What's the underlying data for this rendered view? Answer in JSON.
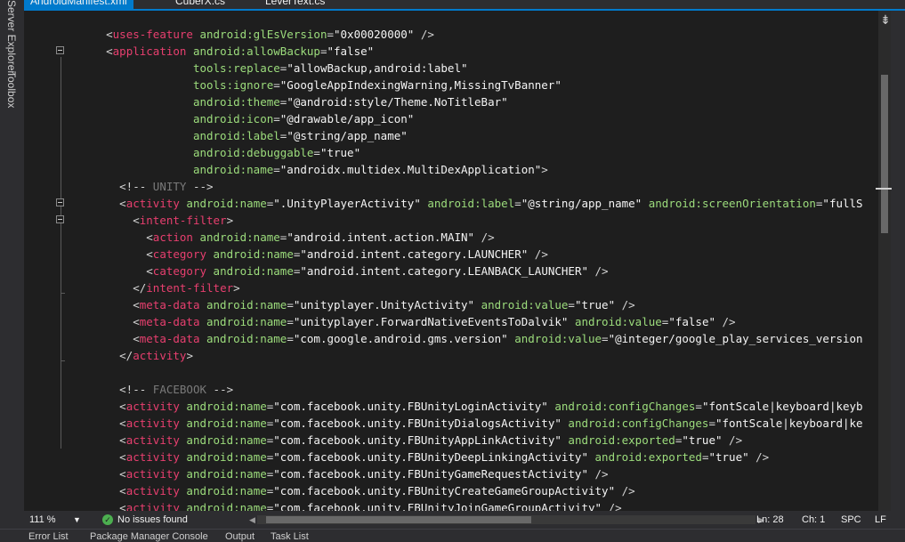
{
  "sidebar": {
    "server_explorer": "Server Explorer",
    "toolbox": "Toolbox"
  },
  "tabs": [
    {
      "label": "AndroidManifest.xml",
      "active": true
    },
    {
      "label": "CuberX.cs",
      "active": false
    },
    {
      "label": "LeverText.cs",
      "active": false
    }
  ],
  "code_lines": [
    [
      [
        "    ",
        "b"
      ],
      [
        "<",
        "b"
      ],
      [
        "uses-feature",
        "e"
      ],
      [
        " android:glEsVersion",
        "a"
      ],
      [
        "=",
        "b"
      ],
      [
        "\"0x00020000\"",
        "v"
      ],
      [
        " />",
        "b"
      ]
    ],
    [
      [
        "    ",
        "b"
      ],
      [
        "<",
        "b"
      ],
      [
        "application",
        "e"
      ],
      [
        " android:allowBackup",
        "a"
      ],
      [
        "=",
        "b"
      ],
      [
        "\"false\"",
        "v"
      ]
    ],
    [
      [
        "                 ",
        "b"
      ],
      [
        "tools:replace",
        "a"
      ],
      [
        "=",
        "b"
      ],
      [
        "\"allowBackup,android:label\"",
        "v"
      ]
    ],
    [
      [
        "                 ",
        "b"
      ],
      [
        "tools:ignore",
        "a"
      ],
      [
        "=",
        "b"
      ],
      [
        "\"GoogleAppIndexingWarning,MissingTvBanner\"",
        "v"
      ]
    ],
    [
      [
        "                 ",
        "b"
      ],
      [
        "android:theme",
        "a"
      ],
      [
        "=",
        "b"
      ],
      [
        "\"@android:style/Theme.NoTitleBar\"",
        "v"
      ]
    ],
    [
      [
        "                 ",
        "b"
      ],
      [
        "android:icon",
        "a"
      ],
      [
        "=",
        "b"
      ],
      [
        "\"@drawable/app_icon\"",
        "v"
      ]
    ],
    [
      [
        "                 ",
        "b"
      ],
      [
        "android:label",
        "a"
      ],
      [
        "=",
        "b"
      ],
      [
        "\"@string/app_name\"",
        "v"
      ]
    ],
    [
      [
        "                 ",
        "b"
      ],
      [
        "android:debuggable",
        "a"
      ],
      [
        "=",
        "b"
      ],
      [
        "\"true\"",
        "v"
      ]
    ],
    [
      [
        "                 ",
        "b"
      ],
      [
        "android:name",
        "a"
      ],
      [
        "=",
        "b"
      ],
      [
        "\"androidx.multidex.MultiDexApplication\"",
        "v"
      ],
      [
        ">",
        "b"
      ]
    ],
    [
      [
        "      ",
        "b"
      ],
      [
        "<!-- ",
        "b"
      ],
      [
        "UNITY",
        "c"
      ],
      [
        " -->",
        "b"
      ]
    ],
    [
      [
        "      ",
        "b"
      ],
      [
        "<",
        "b"
      ],
      [
        "activity",
        "e"
      ],
      [
        " android:name",
        "a"
      ],
      [
        "=",
        "b"
      ],
      [
        "\".UnityPlayerActivity\"",
        "v"
      ],
      [
        " android:label",
        "a"
      ],
      [
        "=",
        "b"
      ],
      [
        "\"@string/app_name\"",
        "v"
      ],
      [
        " android:screenOrientation",
        "a"
      ],
      [
        "=",
        "b"
      ],
      [
        "\"fullS",
        "v"
      ]
    ],
    [
      [
        "        ",
        "b"
      ],
      [
        "<",
        "b"
      ],
      [
        "intent-filter",
        "e"
      ],
      [
        ">",
        "b"
      ]
    ],
    [
      [
        "          ",
        "b"
      ],
      [
        "<",
        "b"
      ],
      [
        "action",
        "e"
      ],
      [
        " android:name",
        "a"
      ],
      [
        "=",
        "b"
      ],
      [
        "\"android.intent.action.MAIN\"",
        "v"
      ],
      [
        " />",
        "b"
      ]
    ],
    [
      [
        "          ",
        "b"
      ],
      [
        "<",
        "b"
      ],
      [
        "category",
        "e"
      ],
      [
        " android:name",
        "a"
      ],
      [
        "=",
        "b"
      ],
      [
        "\"android.intent.category.LAUNCHER\"",
        "v"
      ],
      [
        " />",
        "b"
      ]
    ],
    [
      [
        "          ",
        "b"
      ],
      [
        "<",
        "b"
      ],
      [
        "category",
        "e"
      ],
      [
        " android:name",
        "a"
      ],
      [
        "=",
        "b"
      ],
      [
        "\"android.intent.category.LEANBACK_LAUNCHER\"",
        "v"
      ],
      [
        " />",
        "b"
      ]
    ],
    [
      [
        "        ",
        "b"
      ],
      [
        "</",
        "b"
      ],
      [
        "intent-filter",
        "e"
      ],
      [
        ">",
        "b"
      ]
    ],
    [
      [
        "        ",
        "b"
      ],
      [
        "<",
        "b"
      ],
      [
        "meta-data",
        "e"
      ],
      [
        " android:name",
        "a"
      ],
      [
        "=",
        "b"
      ],
      [
        "\"unityplayer.UnityActivity\"",
        "v"
      ],
      [
        " android:value",
        "a"
      ],
      [
        "=",
        "b"
      ],
      [
        "\"true\"",
        "v"
      ],
      [
        " />",
        "b"
      ]
    ],
    [
      [
        "        ",
        "b"
      ],
      [
        "<",
        "b"
      ],
      [
        "meta-data",
        "e"
      ],
      [
        " android:name",
        "a"
      ],
      [
        "=",
        "b"
      ],
      [
        "\"unityplayer.ForwardNativeEventsToDalvik\"",
        "v"
      ],
      [
        " android:value",
        "a"
      ],
      [
        "=",
        "b"
      ],
      [
        "\"false\"",
        "v"
      ],
      [
        " />",
        "b"
      ]
    ],
    [
      [
        "        ",
        "b"
      ],
      [
        "<",
        "b"
      ],
      [
        "meta-data",
        "e"
      ],
      [
        " android:name",
        "a"
      ],
      [
        "=",
        "b"
      ],
      [
        "\"com.google.android.gms.version\"",
        "v"
      ],
      [
        " android:value",
        "a"
      ],
      [
        "=",
        "b"
      ],
      [
        "\"@integer/google_play_services_version",
        "v"
      ]
    ],
    [
      [
        "      ",
        "b"
      ],
      [
        "</",
        "b"
      ],
      [
        "activity",
        "e"
      ],
      [
        ">",
        "b"
      ]
    ],
    [
      [
        "",
        "b"
      ]
    ],
    [
      [
        "      ",
        "b"
      ],
      [
        "<!-- ",
        "b"
      ],
      [
        "FACEBOOK",
        "c"
      ],
      [
        " -->",
        "b"
      ]
    ],
    [
      [
        "      ",
        "b"
      ],
      [
        "<",
        "b"
      ],
      [
        "activity",
        "e"
      ],
      [
        " android:name",
        "a"
      ],
      [
        "=",
        "b"
      ],
      [
        "\"com.facebook.unity.FBUnityLoginActivity\"",
        "v"
      ],
      [
        " android:configChanges",
        "a"
      ],
      [
        "=",
        "b"
      ],
      [
        "\"fontScale|keyboard|keyb",
        "v"
      ]
    ],
    [
      [
        "      ",
        "b"
      ],
      [
        "<",
        "b"
      ],
      [
        "activity",
        "e"
      ],
      [
        " android:name",
        "a"
      ],
      [
        "=",
        "b"
      ],
      [
        "\"com.facebook.unity.FBUnityDialogsActivity\"",
        "v"
      ],
      [
        " android:configChanges",
        "a"
      ],
      [
        "=",
        "b"
      ],
      [
        "\"fontScale|keyboard|ke",
        "v"
      ]
    ],
    [
      [
        "      ",
        "b"
      ],
      [
        "<",
        "b"
      ],
      [
        "activity",
        "e"
      ],
      [
        " android:name",
        "a"
      ],
      [
        "=",
        "b"
      ],
      [
        "\"com.facebook.unity.FBUnityAppLinkActivity\"",
        "v"
      ],
      [
        " android:exported",
        "a"
      ],
      [
        "=",
        "b"
      ],
      [
        "\"true\"",
        "v"
      ],
      [
        " />",
        "b"
      ]
    ],
    [
      [
        "      ",
        "b"
      ],
      [
        "<",
        "b"
      ],
      [
        "activity",
        "e"
      ],
      [
        " android:name",
        "a"
      ],
      [
        "=",
        "b"
      ],
      [
        "\"com.facebook.unity.FBUnityDeepLinkingActivity\"",
        "v"
      ],
      [
        " android:exported",
        "a"
      ],
      [
        "=",
        "b"
      ],
      [
        "\"true\"",
        "v"
      ],
      [
        " />",
        "b"
      ]
    ],
    [
      [
        "      ",
        "b"
      ],
      [
        "<",
        "b"
      ],
      [
        "activity",
        "e"
      ],
      [
        " android:name",
        "a"
      ],
      [
        "=",
        "b"
      ],
      [
        "\"com.facebook.unity.FBUnityGameRequestActivity\"",
        "v"
      ],
      [
        " />",
        "b"
      ]
    ],
    [
      [
        "      ",
        "b"
      ],
      [
        "<",
        "b"
      ],
      [
        "activity",
        "e"
      ],
      [
        " android:name",
        "a"
      ],
      [
        "=",
        "b"
      ],
      [
        "\"com.facebook.unity.FBUnityCreateGameGroupActivity\"",
        "v"
      ],
      [
        " />",
        "b"
      ]
    ],
    [
      [
        "      ",
        "b"
      ],
      [
        "<",
        "b"
      ],
      [
        "activity",
        "e"
      ],
      [
        " android:name",
        "a"
      ],
      [
        "=",
        "b"
      ],
      [
        "\"com.facebook.unity.FBUnityJoinGameGroupActivity\"",
        "v"
      ],
      [
        " />",
        "b"
      ]
    ]
  ],
  "status": {
    "zoom": "111 %",
    "issues": "No issues found",
    "line": "Ln: 28",
    "col": "Ch: 1",
    "spacing": "SPC",
    "line_ending": "LF"
  },
  "bottom_tabs": [
    "Error List",
    "Package Manager Console",
    "Output",
    "Task List"
  ],
  "icons": {
    "status_ok": "check-circle-icon",
    "zoom_dropdown": "chevron-down-icon",
    "split": "splitter-icon"
  }
}
